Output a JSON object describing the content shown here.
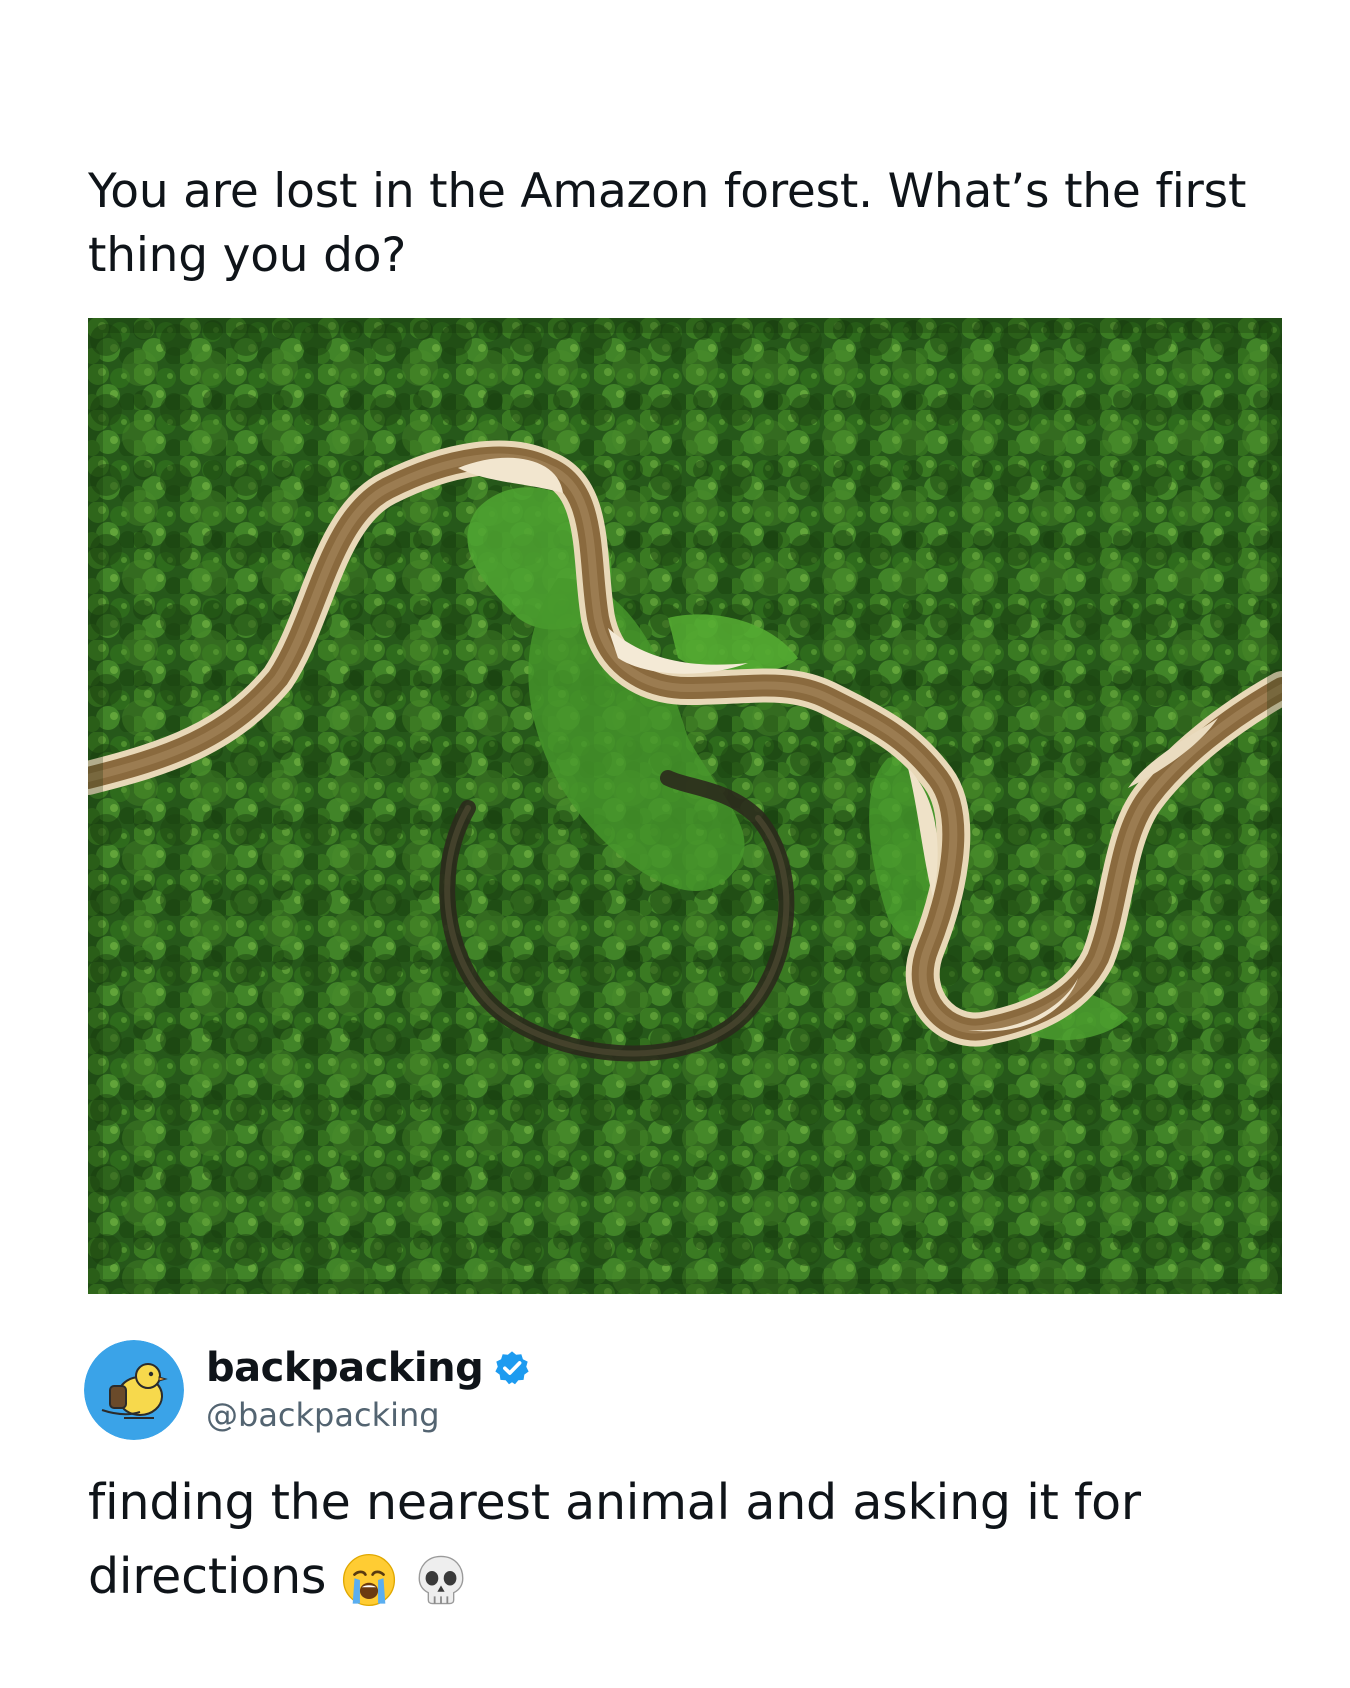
{
  "post": {
    "question_text": "You are lost in the Amazon forest. What’s the first thing you do?"
  },
  "photo": {
    "icon": "aerial-river-forest-photo"
  },
  "author": {
    "display_name": "backpacking",
    "handle": "@backpacking",
    "avatar_icon": "yellow-bird-avatar",
    "verified_icon": "verified-badge-icon",
    "verified_color": "#1d9bf0"
  },
  "reply": {
    "text": "finding the nearest animal and asking it for directions",
    "emojis": [
      "loudly-crying-face-icon",
      "skull-icon"
    ]
  },
  "colors": {
    "background": "#ffffff",
    "text": "#0f1419",
    "secondary_text": "#536471",
    "avatar_bg": "#3aa3e8"
  }
}
